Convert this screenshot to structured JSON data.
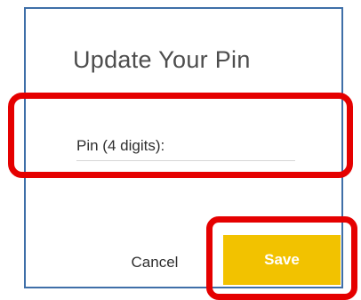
{
  "dialog": {
    "title": "Update Your Pin",
    "pin_field": {
      "label": "Pin (4 digits):",
      "value": ""
    },
    "cancel_label": "Cancel",
    "save_label": "Save"
  },
  "colors": {
    "dialog_border": "#3f6fa8",
    "save_button": "#f2c200",
    "highlight": "#e50000"
  }
}
